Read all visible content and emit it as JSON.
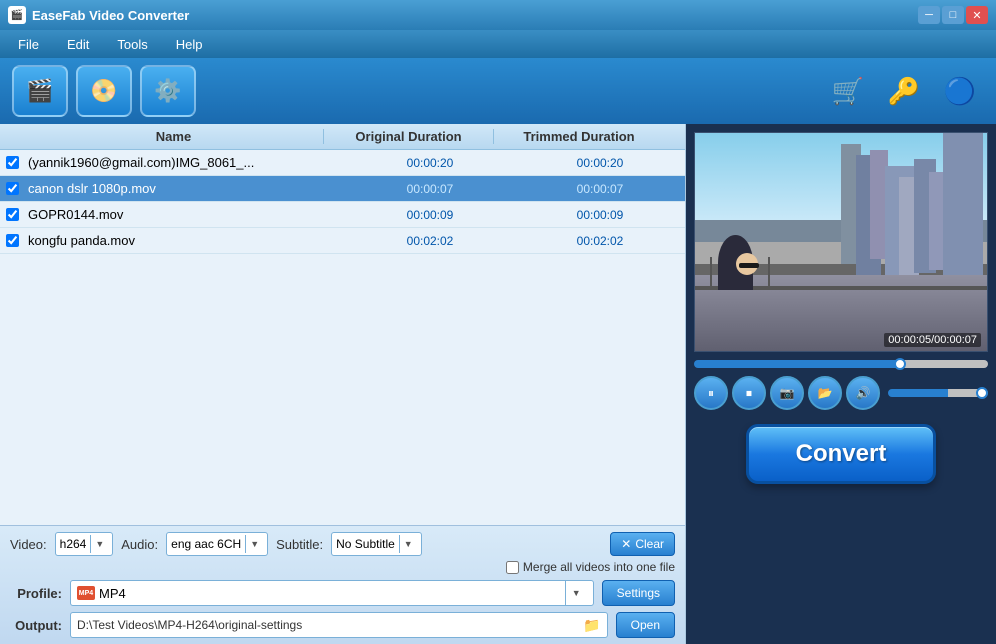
{
  "titlebar": {
    "title": "EaseFab Video Converter",
    "icon": "🎬"
  },
  "menu": {
    "items": [
      "File",
      "Edit",
      "Tools",
      "Help"
    ]
  },
  "toolbar": {
    "add_video_label": "➕🎬",
    "add_dvd_label": "📀",
    "settings_label": "⚙️",
    "cart_icon": "🛒",
    "key_icon": "🔑",
    "help_icon": "🔵"
  },
  "table": {
    "headers": {
      "name": "Name",
      "original_duration": "Original Duration",
      "trimmed_duration": "Trimmed Duration"
    }
  },
  "files": [
    {
      "name": "(yannik1960@gmail.com)IMG_8061_...",
      "original": "00:00:20",
      "trimmed": "00:00:20",
      "checked": true,
      "selected": false
    },
    {
      "name": "canon dslr 1080p.mov",
      "original": "00:00:07",
      "trimmed": "00:00:07",
      "checked": true,
      "selected": true
    },
    {
      "name": "GOPR0144.mov",
      "original": "00:00:09",
      "trimmed": "00:00:09",
      "checked": true,
      "selected": false
    },
    {
      "name": "kongfu panda.mov",
      "original": "00:02:02",
      "trimmed": "00:02:02",
      "checked": true,
      "selected": false
    }
  ],
  "av_controls": {
    "video_label": "Video:",
    "video_value": "h264",
    "audio_label": "Audio:",
    "audio_value": "eng aac 6CH",
    "subtitle_label": "Subtitle:",
    "subtitle_value": "No Subtitle",
    "clear_label": "Clear",
    "merge_label": "Merge all videos into one file"
  },
  "profile": {
    "label": "Profile:",
    "value": "MP4",
    "settings_btn": "Settings"
  },
  "output": {
    "label": "Output:",
    "path": "D:\\Test Videos\\MP4-H264\\original-settings",
    "open_btn": "Open"
  },
  "preview": {
    "time_current": "00:00:05",
    "time_total": "00:00:07",
    "time_display": "00:00:05/00:00:07"
  },
  "convert": {
    "label": "Convert"
  }
}
